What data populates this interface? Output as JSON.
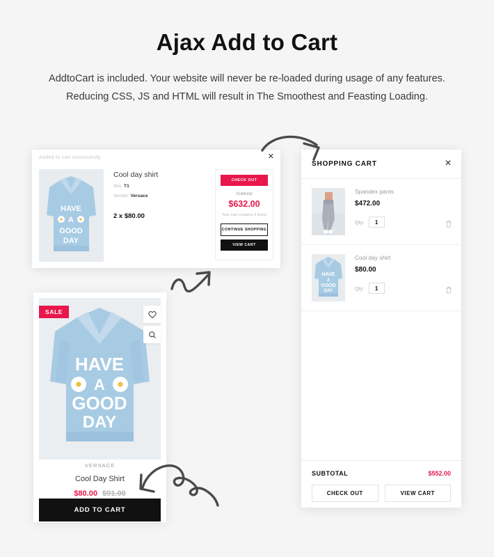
{
  "header": {
    "title": "Ajax Add to Cart",
    "subtitle": "AddtoCart is included. Your website will never be re-loaded during usage of any features. Reducing CSS, JS and HTML will result in The Smoothest and Feasting Loading."
  },
  "colors": {
    "accent": "#e8174c",
    "dark": "#111111",
    "page_bg": "#f5f5f5",
    "panel_bg": "#ffffff",
    "muted": "#9b9b9b"
  },
  "popup": {
    "note": "Added to cart successfully.",
    "close_icon": "close-icon",
    "product": {
      "title": "Cool day shirt",
      "sku_label": "Sku:",
      "sku_value": "T1",
      "vendor_label": "Vendor:",
      "vendor_value": "Versace",
      "qty_price": "2 x $80.00",
      "image_alt": "light blue HAVE A GOOD DAY hoodie"
    },
    "summary": {
      "checkout_label": "CHECK OUT",
      "subtotal_label": "Subtotal",
      "subtotal_amount": "$632.00",
      "items_note": "Your cart contains 3 items",
      "continue_label": "CONTINUE SHOPPING",
      "viewcart_label": "VIEW CART"
    }
  },
  "product_card": {
    "badge": "SALE",
    "wishlist_icon": "heart-icon",
    "quickview_icon": "search-icon",
    "vendor": "VERSACE",
    "name": "Cool Day Shirt",
    "sale_price": "$80.00",
    "old_price": "$91.00",
    "add_to_cart_label": "ADD TO CART",
    "image_alt": "light blue HAVE A GOOD DAY hoodie"
  },
  "cart": {
    "title": "SHOPPING CART",
    "close_icon": "close-icon",
    "items": [
      {
        "name": "Spandex pants",
        "price": "$472.00",
        "qty_label": "Qty:",
        "qty": "1",
        "remove_icon": "trash-icon",
        "image_alt": "grey spandex pants"
      },
      {
        "name": "Cool day shirt",
        "price": "$80.00",
        "qty_label": "Qty:",
        "qty": "1",
        "remove_icon": "trash-icon",
        "image_alt": "light blue HAVE A GOOD DAY hoodie"
      }
    ],
    "footer": {
      "subtotal_label": "SUBTOTAL",
      "subtotal_amount": "$552.00",
      "checkout_label": "CHECK OUT",
      "viewcart_label": "VIEW CART"
    }
  },
  "annotations": {
    "arrow_top": "curved-arrow-right",
    "arrow_middle": "zigzag-arrow-up-right",
    "arrow_bottom": "curly-arrow-left-down"
  }
}
